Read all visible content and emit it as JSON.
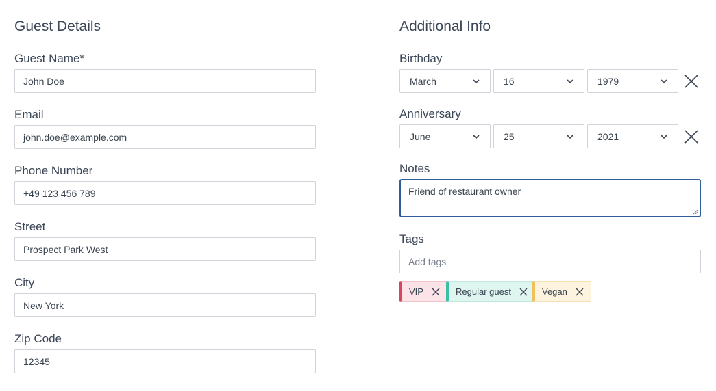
{
  "guest_details": {
    "title": "Guest Details",
    "name": {
      "label": "Guest Name*",
      "value": "John Doe"
    },
    "email": {
      "label": "Email",
      "value": "john.doe@example.com"
    },
    "phone": {
      "label": "Phone Number",
      "value": "+49 123 456 789"
    },
    "street": {
      "label": "Street",
      "value": "Prospect Park West"
    },
    "city": {
      "label": "City",
      "value": "New York"
    },
    "zip": {
      "label": "Zip Code",
      "value": "12345"
    }
  },
  "additional_info": {
    "title": "Additional Info",
    "birthday": {
      "label": "Birthday",
      "month": "March",
      "day": "16",
      "year": "1979"
    },
    "anniversary": {
      "label": "Anniversary",
      "month": "June",
      "day": "25",
      "year": "2021"
    },
    "notes": {
      "label": "Notes",
      "value": "Friend of restaurant owner"
    },
    "tags": {
      "label": "Tags",
      "placeholder": "Add tags",
      "items": [
        {
          "label": "VIP",
          "accent": "#d9455f",
          "bg": "#fbe3e7",
          "border": "#f3c3cc"
        },
        {
          "label": "Regular guest",
          "accent": "#3cbfa2",
          "bg": "#dff5ef",
          "border": "#bfe8dc"
        },
        {
          "label": "Vegan",
          "accent": "#f0c05a",
          "bg": "#fdf3de",
          "border": "#f4e0b3"
        }
      ]
    }
  }
}
